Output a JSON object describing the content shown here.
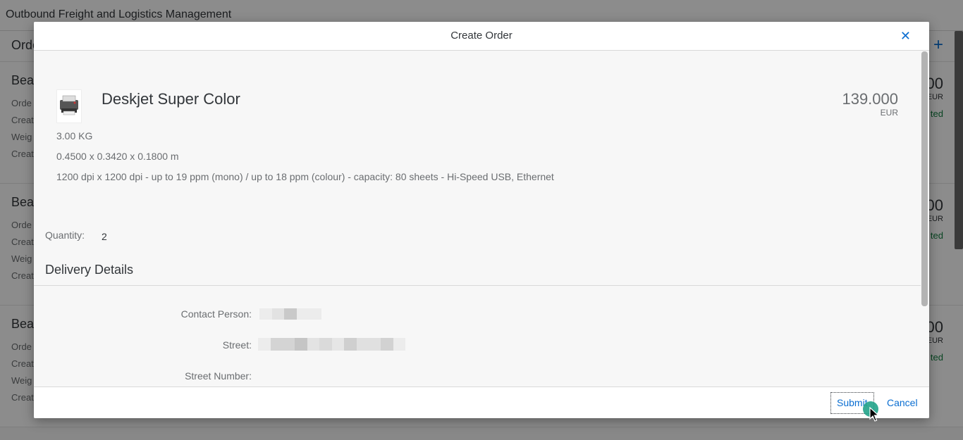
{
  "app": {
    "title": "Outbound Freight and Logistics Management",
    "sub_title": "Orde",
    "add_icon": "+",
    "cards": [
      {
        "title": "Bea",
        "lines": [
          "Orde",
          "Creat",
          "Weig",
          "Creat"
        ],
        "price": "00",
        "currency": "EUR",
        "status": "ted"
      },
      {
        "title": "Bea",
        "lines": [
          "Orde",
          "Creat",
          "Weig",
          "Creat"
        ],
        "price": "00",
        "currency": "EUR",
        "status": "ted"
      },
      {
        "title": "Bea",
        "lines": [
          "Orde",
          "Creat",
          "Weig",
          "Creat"
        ],
        "price": "00",
        "currency": "EUR",
        "status": "ted"
      }
    ]
  },
  "dialog": {
    "title": "Create Order",
    "close_icon": "✕",
    "product": {
      "name": "Deskjet Super Color",
      "image_icon": "printer-icon",
      "price": "139.000",
      "currency": "EUR",
      "weight": "3.00 KG",
      "dimensions": "0.4500 x 0.3420 x 0.1800 m",
      "description": "1200 dpi x 1200 dpi - up to 19 ppm (mono) / up to 18 ppm (colour) - capacity: 80 sheets - Hi-Speed USB, Ethernet"
    },
    "quantity_label": "Quantity:",
    "quantity_value": "2",
    "section_title": "Delivery Details",
    "fields": {
      "contact_person_label": "Contact Person:",
      "street_label": "Street:",
      "street_number_label": "Street Number:"
    },
    "buttons": {
      "submit": "Submit",
      "cancel": "Cancel"
    }
  },
  "colors": {
    "accent": "#0a6ed1",
    "text": "#32363a",
    "muted": "#6a6d70",
    "cursor_highlight": "#21a38a"
  }
}
